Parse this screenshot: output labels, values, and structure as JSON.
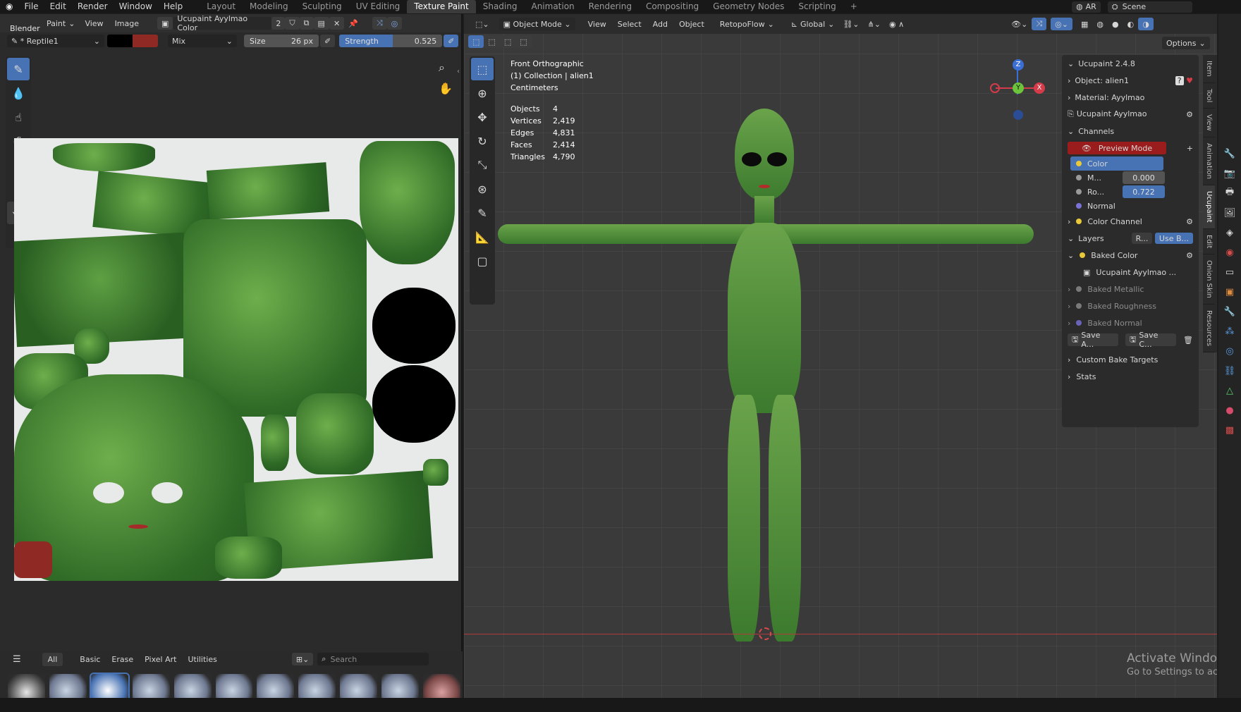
{
  "top_menu": {
    "items": [
      "File",
      "Edit",
      "Render",
      "Window",
      "Help"
    ],
    "workspaces": [
      "Layout",
      "Modeling",
      "Sculpting",
      "UV Editing",
      "Texture Paint",
      "Shading",
      "Animation",
      "Rendering",
      "Compositing",
      "Geometry Nodes",
      "Scripting"
    ],
    "active_workspace": "Texture Paint",
    "plus": "+",
    "right": {
      "ar": "AR",
      "scene": "Scene"
    }
  },
  "image_editor": {
    "tooltip": "Blender",
    "header": {
      "mode": "Paint",
      "view": "View",
      "image": "Image",
      "image_name": "Ucupaint Ayylmao Color",
      "users": "2"
    },
    "brush_header": {
      "brush_name": "* Reptile1",
      "blend": "Mix",
      "size_label": "Size",
      "size_value": "26 px",
      "strength_label": "Strength",
      "strength_value": "0.525"
    },
    "brush_categories": [
      "All",
      "Basic",
      "Erase",
      "Pixel Art",
      "Utilities"
    ],
    "active_category": "All",
    "search_placeholder": "Search"
  },
  "viewport": {
    "header": {
      "mode": "Object Mode",
      "view": "View",
      "select": "Select",
      "add": "Add",
      "object": "Object",
      "retopoflow": "RetopoFlow",
      "orientation": "Global",
      "options": "Options"
    },
    "overlay": {
      "view_name": "Front Orthographic",
      "collection": "(1) Collection | alien1",
      "units": "Centimeters",
      "stats": [
        {
          "label": "Objects",
          "value": "4"
        },
        {
          "label": "Vertices",
          "value": "2,419"
        },
        {
          "label": "Edges",
          "value": "4,831"
        },
        {
          "label": "Faces",
          "value": "2,414"
        },
        {
          "label": "Triangles",
          "value": "4,790"
        }
      ]
    },
    "gizmo": {
      "z": "Z",
      "y": "Y",
      "x": "X"
    },
    "watermark": {
      "title": "Activate Windows",
      "subtitle": "Go to Settings to activate"
    }
  },
  "ucupaint": {
    "title": "Ucupaint 2.4.8",
    "object": "Object: alien1",
    "material": "Material: Ayylmao",
    "node": "Ucupaint Ayylmao",
    "channels_label": "Channels",
    "preview_mode": "Preview Mode",
    "channel_items": [
      {
        "label": "Color",
        "value": ""
      },
      {
        "label": "M...",
        "value": "0.000"
      },
      {
        "label": "Ro...",
        "value": "0.722"
      },
      {
        "label": "Normal",
        "value": ""
      }
    ],
    "color_channel": "Color Channel",
    "layers_label": "Layers",
    "layers_btn1": "R...",
    "layers_btn2": "Use B...",
    "layers": [
      {
        "label": "Baked Color",
        "active": true
      },
      {
        "label": "Baked Metallic",
        "active": false
      },
      {
        "label": "Baked Roughness",
        "active": false
      },
      {
        "label": "Baked Normal",
        "active": false
      }
    ],
    "layer_image": "Ucupaint Ayylmao ...",
    "save_a": "Save A...",
    "save_c": "Save C...",
    "custom_bake": "Custom Bake Targets",
    "stats": "Stats"
  },
  "side_tabs": [
    "Item",
    "Tool",
    "View",
    "Animation",
    "Ucupaint",
    "Edit",
    "Onion Skin",
    "Resources"
  ],
  "active_side_tab": "Ucupaint",
  "colors": {
    "accent": "#4772b3",
    "preview_red": "#9b1c1c",
    "green_skin": "#4d8a38"
  }
}
